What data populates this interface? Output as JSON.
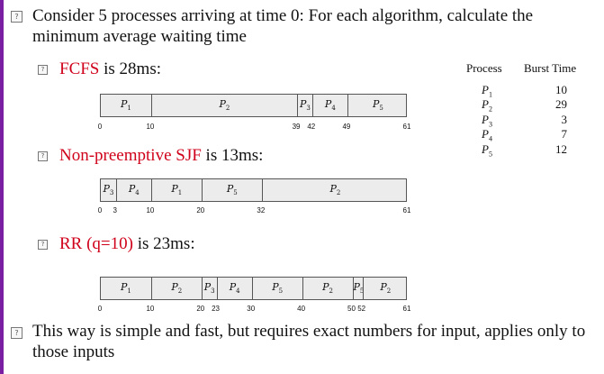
{
  "intro": "Consider 5 processes arriving at time 0: For each algorithm, calculate the minimum average waiting time",
  "sections": [
    {
      "label": "FCFS",
      "suffix": " is 28ms:",
      "color": "#d0021b"
    },
    {
      "label": "Non-preemptive SJF",
      "suffix": " is 13ms:",
      "color": "#d0021b"
    },
    {
      "label": "RR (q=10)",
      "suffix": " is 23ms:",
      "color": "#d0021b"
    }
  ],
  "conclusion": "This way is simple and fast, but requires exact numbers for input, applies only to those inputs",
  "table": {
    "headers": [
      "Process",
      "Burst Time"
    ],
    "rows": [
      {
        "process": "P1",
        "burst": "10"
      },
      {
        "process": "P2",
        "burst": "29"
      },
      {
        "process": "P3",
        "burst": "3"
      },
      {
        "process": "P4",
        "burst": "7"
      },
      {
        "process": "P5",
        "burst": "12"
      }
    ]
  },
  "gantts": [
    {
      "name": "fcfs",
      "total": 61,
      "segments": [
        {
          "p": "1",
          "start": 0,
          "end": 10
        },
        {
          "p": "2",
          "start": 10,
          "end": 39
        },
        {
          "p": "3",
          "start": 39,
          "end": 42
        },
        {
          "p": "4",
          "start": 42,
          "end": 49
        },
        {
          "p": "5",
          "start": 49,
          "end": 61
        }
      ],
      "ticks": [
        "0",
        "10",
        "39",
        "42",
        "49",
        "61"
      ]
    },
    {
      "name": "sjf",
      "total": 61,
      "segments": [
        {
          "p": "3",
          "start": 0,
          "end": 3
        },
        {
          "p": "4",
          "start": 3,
          "end": 10
        },
        {
          "p": "1",
          "start": 10,
          "end": 20
        },
        {
          "p": "5",
          "start": 20,
          "end": 32
        },
        {
          "p": "2",
          "start": 32,
          "end": 61
        }
      ],
      "ticks": [
        "0",
        "3",
        "10",
        "20",
        "32",
        "61"
      ]
    },
    {
      "name": "rr",
      "total": 61,
      "segments": [
        {
          "p": "1",
          "start": 0,
          "end": 10
        },
        {
          "p": "2",
          "start": 10,
          "end": 20
        },
        {
          "p": "3",
          "start": 20,
          "end": 23
        },
        {
          "p": "4",
          "start": 23,
          "end": 30
        },
        {
          "p": "5",
          "start": 30,
          "end": 40
        },
        {
          "p": "2",
          "start": 40,
          "end": 50
        },
        {
          "p": "5",
          "start": 50,
          "end": 52
        },
        {
          "p": "2",
          "start": 52,
          "end": 61
        }
      ],
      "ticks": [
        "0",
        "10",
        "20",
        "23",
        "30",
        "40",
        "50",
        "52",
        "61"
      ]
    }
  ]
}
